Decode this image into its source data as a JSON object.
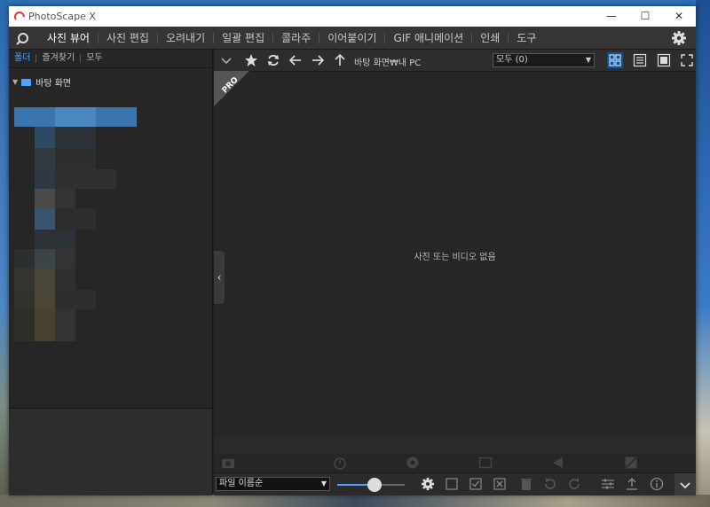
{
  "window": {
    "title": "PhotoScape X",
    "minimize": "—",
    "maximize": "☐",
    "close": "✕"
  },
  "menu": {
    "items": [
      "사진 뷰어",
      "사진 편집",
      "오려내기",
      "일괄 편집",
      "콜라주",
      "이어붙이기",
      "GIF 애니메이션",
      "인쇄",
      "도구"
    ],
    "active_index": 0
  },
  "left_panel": {
    "tabs": [
      "폴더",
      "즐겨찾기",
      "모두"
    ],
    "tree_root": "바탕 화면",
    "tree_arrow": "▼"
  },
  "toolbar": {
    "path": "바탕 화면₩내 PC",
    "filter_value": "모두 (0)",
    "dropdown_arrow": "▼"
  },
  "content": {
    "badge": "PRO",
    "empty_message": "사진 또는 비디오 없음",
    "collapse_glyph": "‹"
  },
  "bottom": {
    "sort_value": "파일 이름순",
    "dropdown_arrow": "▼",
    "zoom_level": 0.55
  },
  "colors": {
    "accent": "#4da3ff",
    "active_view": "#1d4f87"
  }
}
